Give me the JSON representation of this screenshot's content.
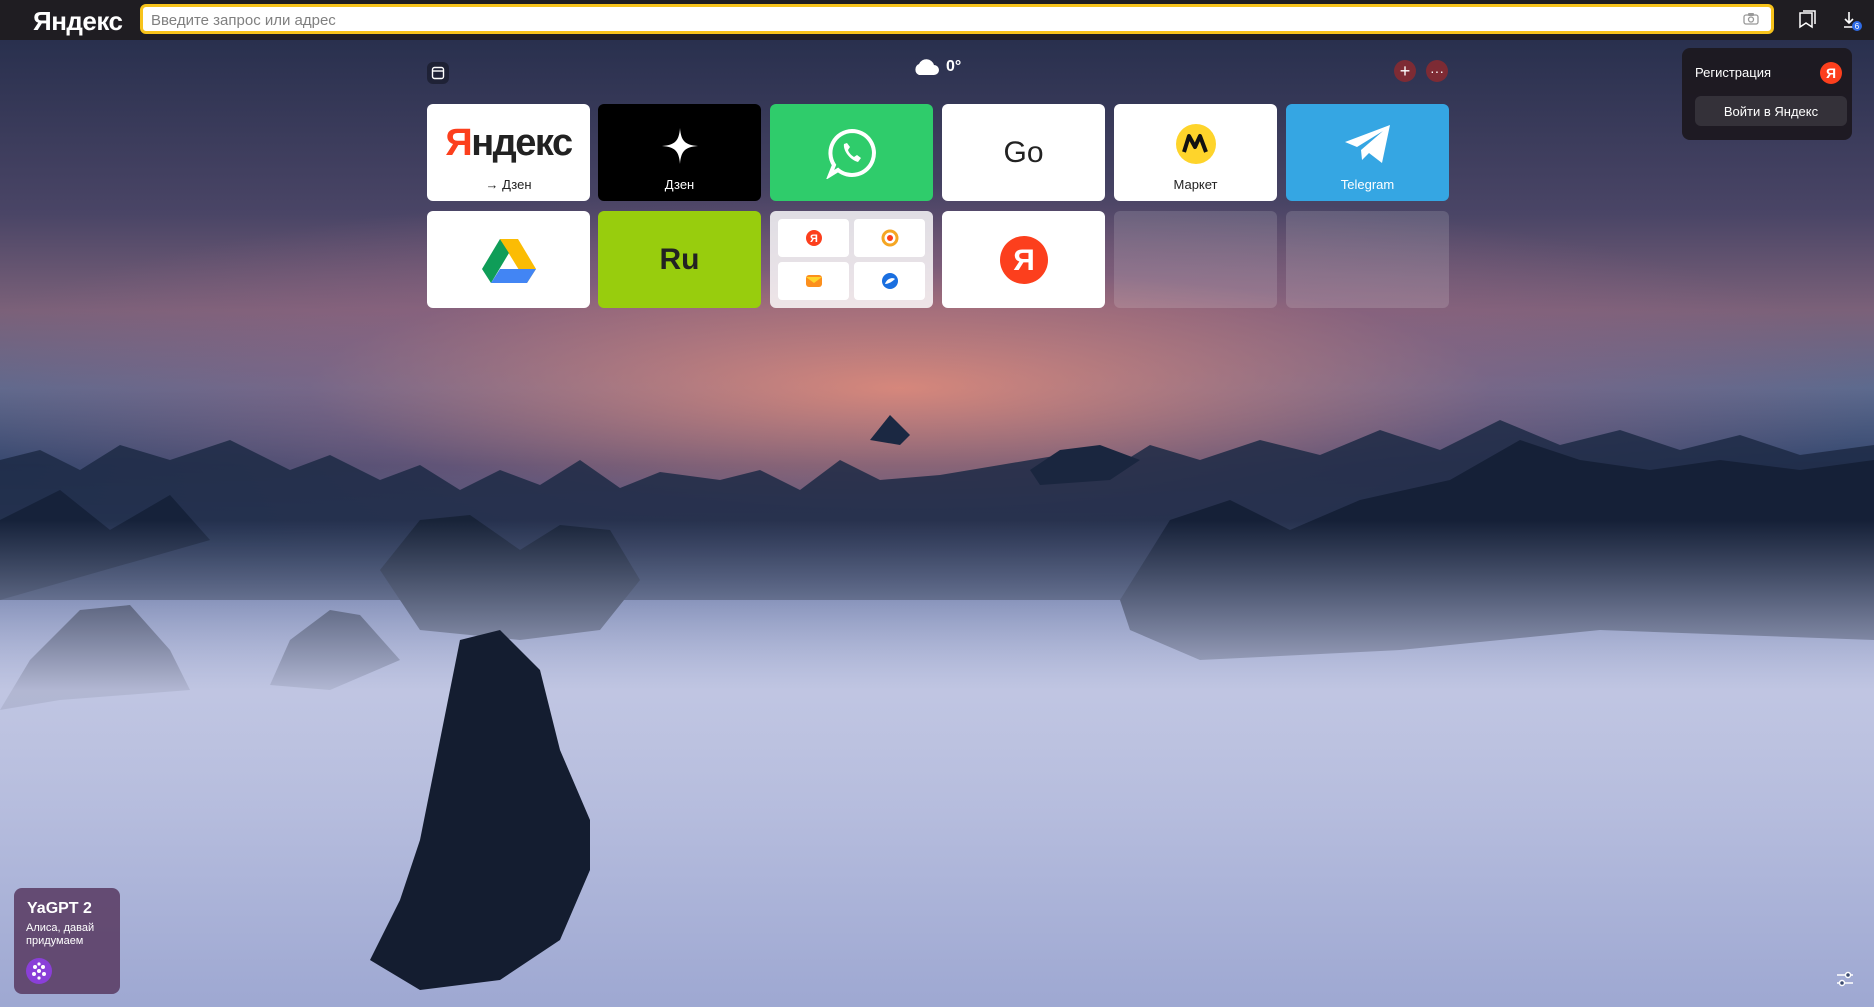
{
  "browser": {
    "logo": "Яндекс",
    "omnibox_placeholder": "Введите запрос или адрес",
    "downloads_badge": "6"
  },
  "widgets": {
    "weather_temp": "0°"
  },
  "tiles": {
    "yandex_caption": "→ Дзен",
    "dzen_caption": "Дзен",
    "go_label": "Go",
    "market_caption": "Маркет",
    "telegram_caption": "Telegram",
    "ru_label": "Ru"
  },
  "login": {
    "title": "Регистрация",
    "button": "Войти в Яндекс",
    "ya_badge": "Я"
  },
  "yagpt": {
    "title": "YaGPT 2",
    "subtitle": "Алиса, давай придумаем"
  },
  "colors": {
    "accent": "#f7c31b",
    "yandex_red": "#fc3f1d",
    "whatsapp": "#2fcc6b",
    "telegram": "#35a6e3",
    "ru_green": "#98cd0d"
  }
}
